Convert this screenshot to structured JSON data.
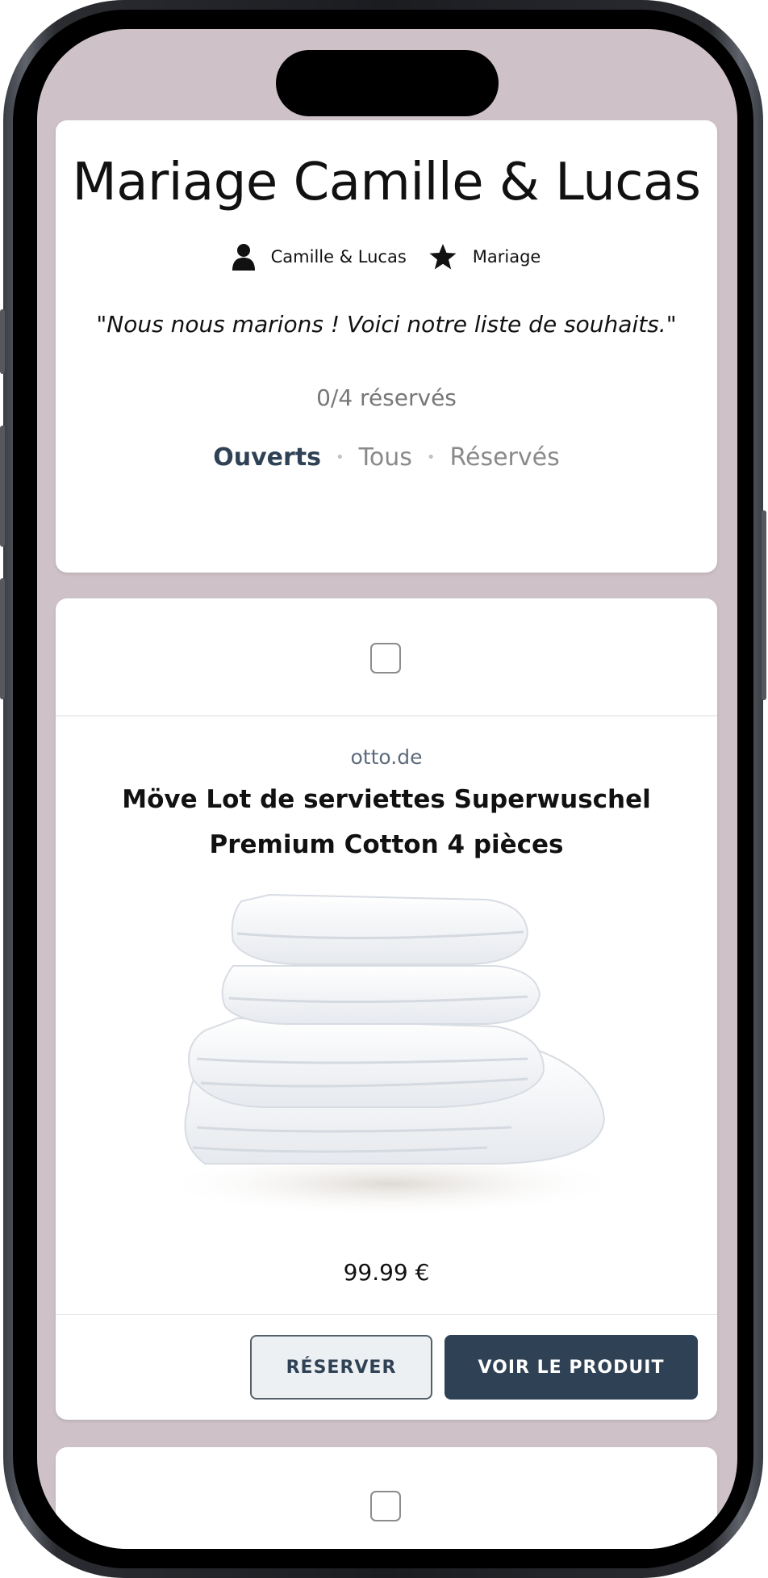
{
  "header": {
    "title": "Mariage Camille & Lucas",
    "owner": "Camille & Lucas",
    "occasion": "Mariage",
    "quote": "\"Nous nous marions ! Voici notre liste de souhaits.\"",
    "progress": "0/4 réservés"
  },
  "filters": [
    {
      "label": "Ouverts",
      "active": true
    },
    {
      "label": "Tous",
      "active": false
    },
    {
      "label": "Réservés",
      "active": false
    }
  ],
  "items": [
    {
      "checked": false,
      "domain": "otto.de",
      "title": "Möve Lot de serviettes Superwuschel Premium Cotton 4 pièces",
      "price": "99.99 €",
      "reserve_label": "RÉSERVER",
      "view_label": "VOIR LE PRODUIT"
    }
  ],
  "icons": {
    "owner": "person-icon",
    "occasion": "star-icon"
  },
  "colors": {
    "background": "#cec2c8",
    "primary": "#2f4154"
  }
}
